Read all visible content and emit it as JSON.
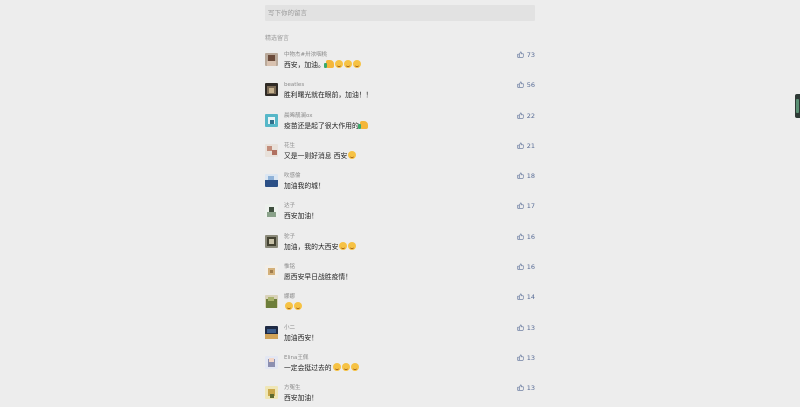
{
  "comment_box": {
    "placeholder": "写下你的留言"
  },
  "section_label": "精选留言",
  "colors": {
    "background": "#ededed",
    "like_blue": "#576b95"
  },
  "comments": [
    {
      "nickname": "中物杰#卅浓咽桃",
      "text": "西安，加油。",
      "emoji": [
        "thumb-icon",
        "smile-icon",
        "smile-icon",
        "smile-icon"
      ],
      "likes": "73"
    },
    {
      "nickname": "beatles",
      "text": "胜利曙光就在眼前，加油！！",
      "emoji": [],
      "likes": "56"
    },
    {
      "nickname": "晨晞靓澜ox",
      "text": "疫苗还是起了很大作用的",
      "emoji": [
        "thumb-icon"
      ],
      "likes": "22"
    },
    {
      "nickname": "花生",
      "text": "又是一则好消息 西安",
      "emoji": [
        "smile-icon"
      ],
      "likes": "21"
    },
    {
      "nickname": "吹感倫",
      "text": "加油我的城！",
      "emoji": [],
      "likes": "18"
    },
    {
      "nickname": "达子",
      "text": "西安加油！",
      "emoji": [],
      "likes": "17"
    },
    {
      "nickname": "驼子",
      "text": "加油，我的大西安",
      "emoji": [
        "smile-icon",
        "smile-icon"
      ],
      "likes": "16"
    },
    {
      "nickname": "惟铭",
      "text": "愿西安早日战胜疫情！",
      "emoji": [],
      "likes": "16"
    },
    {
      "nickname": "娜娜",
      "text": "",
      "emoji": [
        "smile-icon",
        "smile-icon"
      ],
      "likes": "14"
    },
    {
      "nickname": "小二",
      "text": "加油西安！",
      "emoji": [],
      "likes": "13"
    },
    {
      "nickname": "Elina王佩",
      "text": "一定会挺过去的",
      "emoji": [
        "smile-icon",
        "smile-icon",
        "smile-icon"
      ],
      "likes": "13"
    },
    {
      "nickname": "方冤生",
      "text": "西安加油！",
      "emoji": [],
      "likes": "13"
    }
  ]
}
